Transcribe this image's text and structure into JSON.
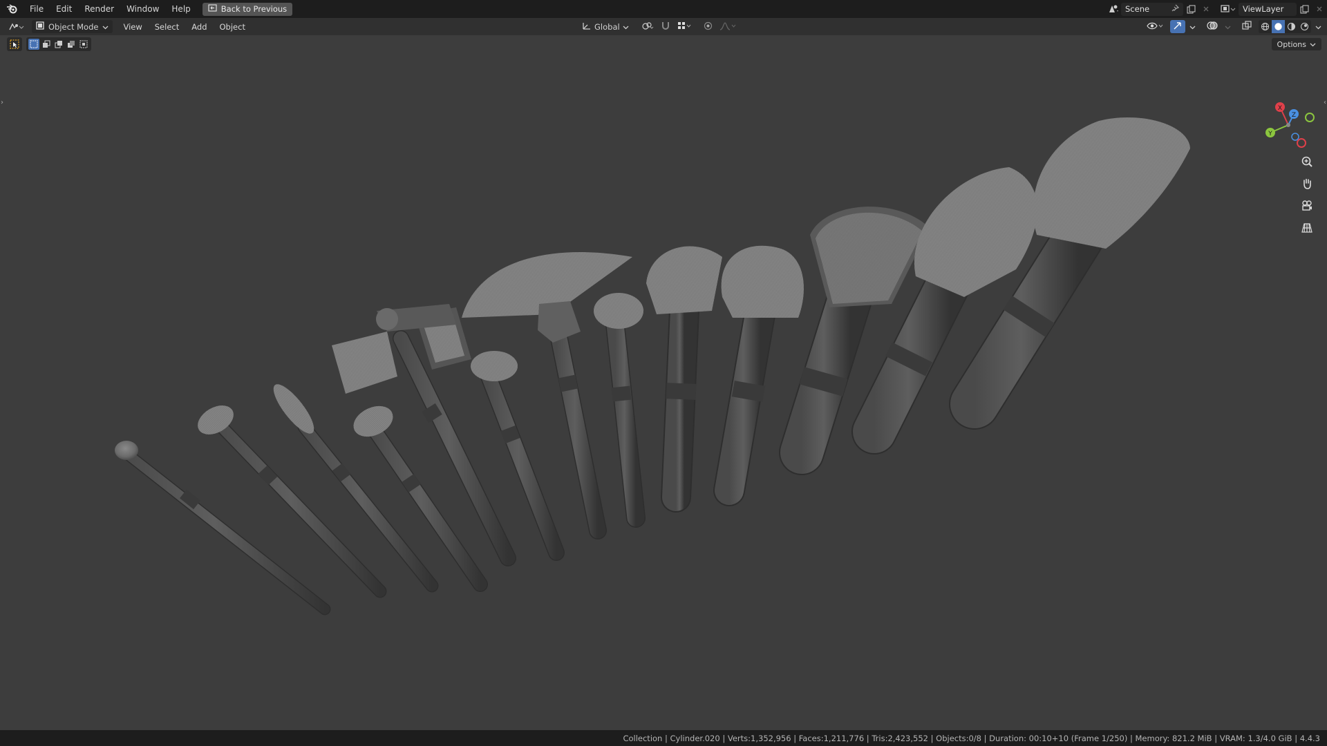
{
  "topbar": {
    "menus": [
      "File",
      "Edit",
      "Render",
      "Window",
      "Help"
    ],
    "back_button": "Back to Previous",
    "scene": "Scene",
    "view_layer": "ViewLayer"
  },
  "header": {
    "mode": "Object Mode",
    "menus": [
      "View",
      "Select",
      "Add",
      "Object"
    ],
    "transform_orientation": "Global"
  },
  "toolbar": {
    "options_label": "Options"
  },
  "gizmo": {
    "x": "X",
    "y": "Y",
    "z": "Z"
  },
  "statusbar": {
    "text": "Collection | Cylinder.020 | Verts:1,352,956 | Faces:1,211,776 | Tris:2,423,552 | Objects:0/8 | Duration: 00:10+10 (Frame 1/250) | Memory: 821.2 MiB | VRAM: 1.3/4.0 GiB | 4.4.3"
  },
  "icons": {
    "logo": "blender-logo-icon",
    "shading_active": "solid-shading-icon"
  },
  "colors": {
    "accent": "#4772b3",
    "viewport_bg": "#3d3d3d",
    "axis_x": "#e0404a",
    "axis_y": "#8cc63f",
    "axis_z": "#4a90e2"
  }
}
